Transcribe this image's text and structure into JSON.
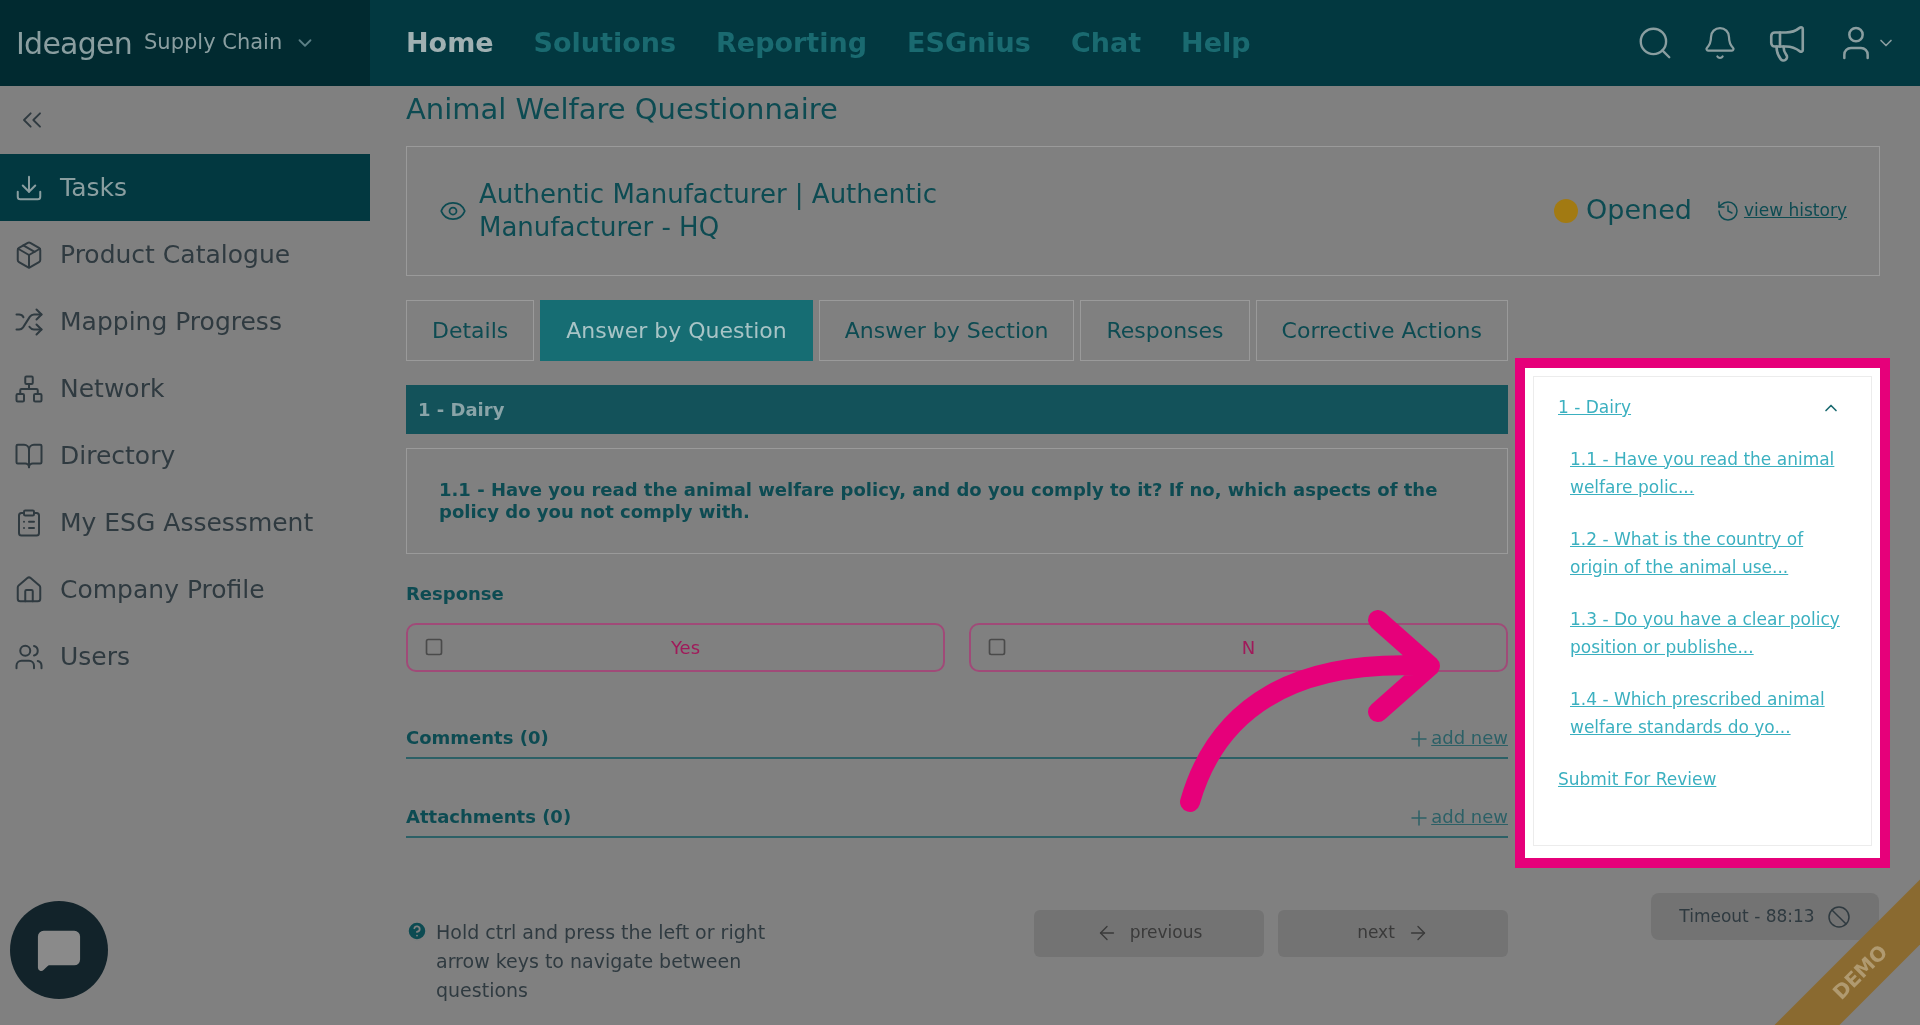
{
  "header": {
    "logo": "Ideagen",
    "product": "Supply Chain",
    "nav": [
      {
        "label": "Home",
        "selected": true
      },
      {
        "label": "Solutions",
        "selected": false
      },
      {
        "label": "Reporting",
        "selected": false
      },
      {
        "label": "ESGnius",
        "selected": false
      },
      {
        "label": "Chat",
        "selected": false
      },
      {
        "label": "Help",
        "selected": false
      }
    ]
  },
  "sidebar": {
    "items": [
      {
        "label": "Tasks",
        "selected": true
      },
      {
        "label": "Product Catalogue",
        "selected": false
      },
      {
        "label": "Mapping Progress",
        "selected": false
      },
      {
        "label": "Network",
        "selected": false
      },
      {
        "label": "Directory",
        "selected": false
      },
      {
        "label": "My ESG Assessment",
        "selected": false
      },
      {
        "label": "Company Profile",
        "selected": false
      },
      {
        "label": "Users",
        "selected": false
      }
    ]
  },
  "page_title": "Animal Welfare Questionnaire",
  "record": {
    "name": "Authentic Manufacturer | Authentic Manufacturer - HQ",
    "status": "Opened",
    "history_link": "view history"
  },
  "tabs": [
    {
      "label": "Details",
      "selected": false
    },
    {
      "label": "Answer by Question",
      "selected": true
    },
    {
      "label": "Answer by Section",
      "selected": false
    },
    {
      "label": "Responses",
      "selected": false
    },
    {
      "label": "Corrective Actions",
      "selected": false
    }
  ],
  "section": "1 - Dairy",
  "question": "1.1 - Have you read the animal welfare policy, and do you comply to it? If no, which aspects of the policy do you not comply with.",
  "response": {
    "label": "Response",
    "options": [
      {
        "label": "Yes",
        "checked": false
      },
      {
        "label": "N",
        "checked": false
      }
    ]
  },
  "panels": [
    {
      "label": "Comments (0)",
      "action": "add new"
    },
    {
      "label": "Attachments (0)",
      "action": "add new"
    }
  ],
  "hint": "Hold ctrl and press the left or right arrow keys to navigate between questions",
  "nav_buttons": {
    "previous": "previous",
    "next": "next"
  },
  "timeout": "Timeout - 88:13",
  "demo_ribbon": "DEMO",
  "outline": {
    "section": {
      "label": "1 - Dairy",
      "expanded": true
    },
    "questions": [
      "1.1 - Have you read the animal welfare polic...",
      "1.2 - What is the country of origin of the animal use...",
      "1.3 - Do you have a clear policy position or publishe...",
      "1.4 - Which prescribed animal welfare standards do yo..."
    ],
    "submit": "Submit For Review"
  }
}
